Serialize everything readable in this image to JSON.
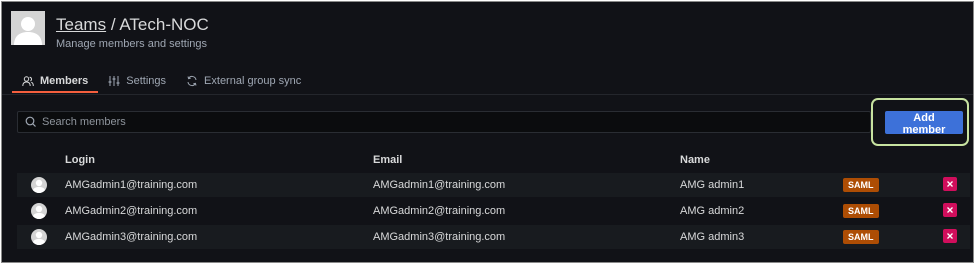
{
  "header": {
    "breadcrumb_root": "Teams",
    "separator": "/",
    "team_name": "ATech-NOC",
    "subtitle": "Manage members and settings"
  },
  "tabs": [
    {
      "label": "Members",
      "icon": "users-icon",
      "active": true
    },
    {
      "label": "Settings",
      "icon": "sliders-icon",
      "active": false
    },
    {
      "label": "External group sync",
      "icon": "sync-icon",
      "active": false
    }
  ],
  "search": {
    "placeholder": "Search members",
    "value": ""
  },
  "add_member_label": "Add member",
  "table": {
    "columns": [
      "Login",
      "Email",
      "Name"
    ],
    "rows": [
      {
        "login": "AMGadmin1@training.com",
        "email": "AMGadmin1@training.com",
        "name": "AMG admin1",
        "badge": "SAML"
      },
      {
        "login": "AMGadmin2@training.com",
        "email": "AMGadmin2@training.com",
        "name": "AMG admin2",
        "badge": "SAML"
      },
      {
        "login": "AMGadmin3@training.com",
        "email": "AMGadmin3@training.com",
        "name": "AMG admin3",
        "badge": "SAML"
      }
    ]
  },
  "colors": {
    "background": "#111217",
    "accent_tab": "#f55f3e",
    "primary_button": "#3d71d9",
    "saml_badge": "#ad4d04",
    "remove_button": "#d10e5c",
    "highlight_outline": "#c7e2a0"
  }
}
